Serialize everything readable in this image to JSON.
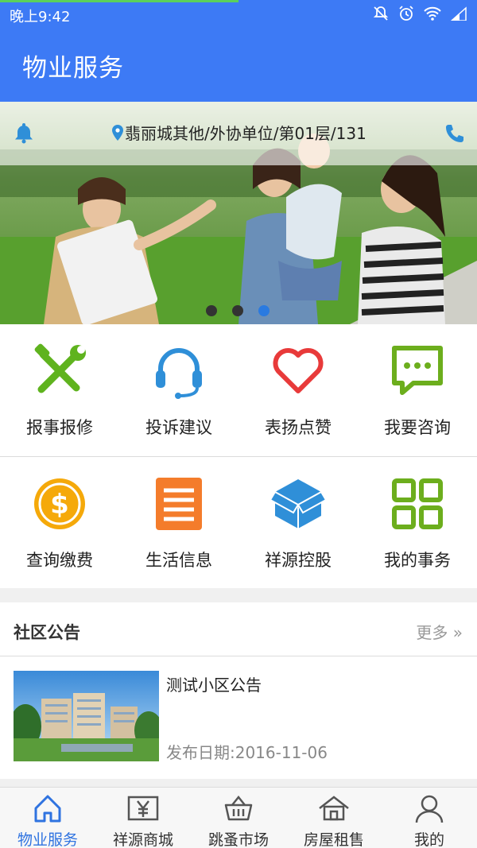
{
  "status_bar": {
    "time": "晚上9:42",
    "icons": [
      "mute-icon",
      "alarm-icon",
      "wifi-icon",
      "signal-icon"
    ]
  },
  "app_bar": {
    "title": "物业服务"
  },
  "banner": {
    "address": "翡丽城其他/外协单位/第01层/131",
    "icons": [
      "bell-icon",
      "location-icon",
      "phone-icon"
    ],
    "page_count": 3,
    "active_page": 3
  },
  "services": [
    {
      "label": "报事报修",
      "icon": "tools-icon",
      "color": "#5fb31e"
    },
    {
      "label": "投诉建议",
      "icon": "headset-icon",
      "color": "#2f8fd8"
    },
    {
      "label": "表扬点赞",
      "icon": "heart-icon",
      "color": "#e83a3a"
    },
    {
      "label": "我要咨询",
      "icon": "chat-icon",
      "color": "#6cae1d"
    },
    {
      "label": "查询缴费",
      "icon": "coin-icon",
      "color": "#f5a90a"
    },
    {
      "label": "生活信息",
      "icon": "document-icon",
      "color": "#f47c2b"
    },
    {
      "label": "祥源控股",
      "icon": "box-icon",
      "color": "#2f8fd8"
    },
    {
      "label": "我的事务",
      "icon": "grid-icon",
      "color": "#6cae1d"
    }
  ],
  "notice": {
    "title": "社区公告",
    "more": "更多 »",
    "items": [
      {
        "title": "测试小区公告",
        "date": "发布日期:2016-11-06"
      }
    ]
  },
  "bottom_nav": [
    {
      "label": "物业服务",
      "icon": "home-icon",
      "active": true
    },
    {
      "label": "祥源商城",
      "icon": "yen-icon",
      "active": false
    },
    {
      "label": "跳蚤市场",
      "icon": "basket-icon",
      "active": false
    },
    {
      "label": "房屋租售",
      "icon": "house-icon",
      "active": false
    },
    {
      "label": "我的",
      "icon": "user-icon",
      "active": false
    }
  ],
  "colors": {
    "primary": "#3d7af5",
    "nav_active": "#2f73e0"
  }
}
